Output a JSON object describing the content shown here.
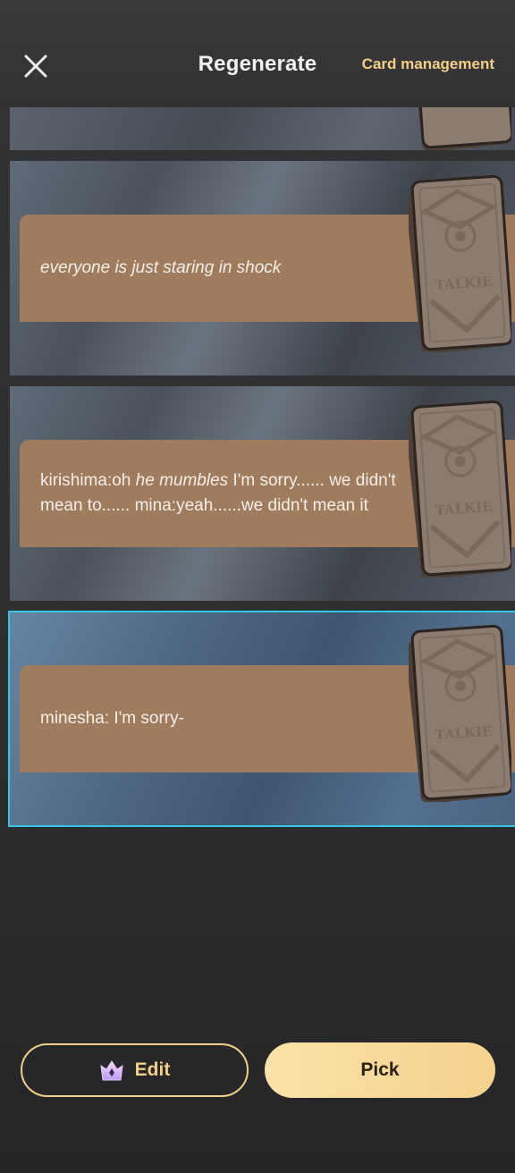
{
  "header": {
    "title": "Regenerate",
    "card_management_label": "Card management",
    "close_icon": "close-icon"
  },
  "options": [
    {
      "text_plain": ""
    },
    {
      "text_plain": "everyone is just staring in shock"
    },
    {
      "text_part1": "kirishima:oh ",
      "text_italic": "he mumbles",
      "text_part2": " I'm sorry...... we didn't mean to...... mina:yeah......we didn't mean it"
    },
    {
      "text_plain": "minesha: I'm sorry-"
    }
  ],
  "card_icon": "tarot-card-icon",
  "footer": {
    "edit_label": "Edit",
    "edit_icon": "crown-gem-icon",
    "pick_label": "Pick"
  },
  "colors": {
    "accent": "#f0cf86",
    "selected_border": "#33c8e6",
    "bubble": "#a07c5f"
  }
}
